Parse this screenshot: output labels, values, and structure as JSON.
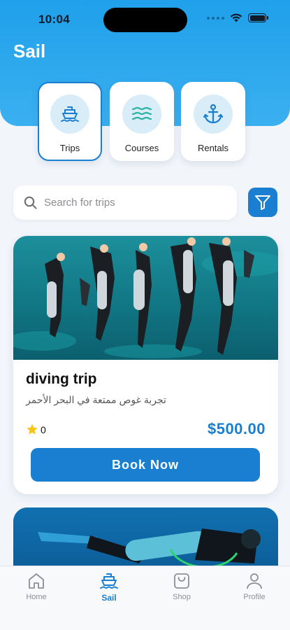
{
  "status_bar": {
    "time": "10:04"
  },
  "header": {
    "title": "Sail"
  },
  "categories": [
    {
      "label": "Trips",
      "icon": "ship-icon",
      "active": true
    },
    {
      "label": "Courses",
      "icon": "waves-icon",
      "active": false
    },
    {
      "label": "Rentals",
      "icon": "anchor-icon",
      "active": false
    }
  ],
  "search": {
    "placeholder": "Search for trips",
    "value": ""
  },
  "trips": [
    {
      "title": "diving trip",
      "description": "تجربة غوص ممتعة في البحر الأحمر",
      "rating": "0",
      "price": "$500.00",
      "book_label": "Book Now"
    }
  ],
  "tabs": [
    {
      "label": "Home",
      "icon": "home-icon",
      "active": false
    },
    {
      "label": "Sail",
      "icon": "ship-icon",
      "active": true
    },
    {
      "label": "Shop",
      "icon": "shopping-bag-icon",
      "active": false
    },
    {
      "label": "Profile",
      "icon": "person-icon",
      "active": false
    }
  ],
  "colors": {
    "accent": "#1a7fd0",
    "header": "#2aa8ee",
    "teal": "#2bb3a3",
    "star": "#f5c518"
  }
}
